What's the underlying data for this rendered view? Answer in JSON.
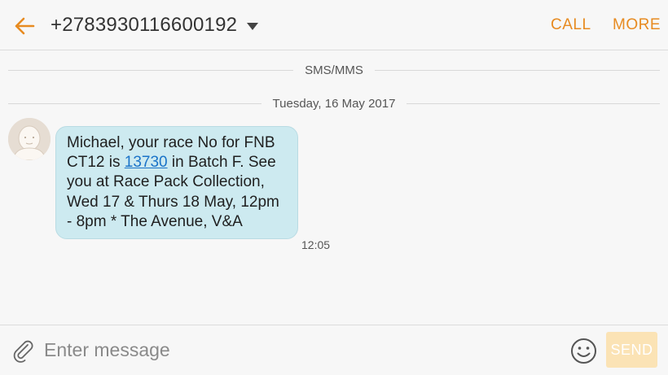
{
  "header": {
    "contact_number": "+2783930116600192",
    "call_label": "CALL",
    "more_label": "MORE"
  },
  "thread": {
    "channel_label": "SMS/MMS",
    "date_label": "Tuesday, 16 May 2017",
    "messages": [
      {
        "text_before": "Michael, your race No for FNB CT12 is ",
        "link_text": "13730",
        "text_after": " in Batch F. See you at Race Pack Collection, Wed 17 & Thurs 18 May, 12pm - 8pm * The Avenue, V&A",
        "time": "12:05"
      }
    ]
  },
  "composer": {
    "placeholder": "Enter message",
    "send_label": "SEND"
  },
  "colors": {
    "accent": "#e78b21",
    "bubble": "#cdeaf0",
    "link": "#1a73c8",
    "send_disabled": "#fbe3b5"
  },
  "icons": {
    "back": "back-arrow-icon",
    "dropdown": "chevron-down-icon",
    "avatar": "default-contact-avatar",
    "attach": "paperclip-icon",
    "emoji": "smiley-icon"
  }
}
